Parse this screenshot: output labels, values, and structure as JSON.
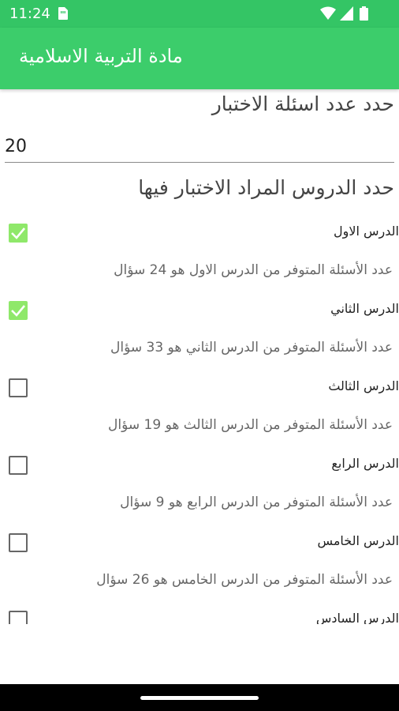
{
  "status_bar": {
    "time": "11:24",
    "icons": [
      "sim-card-icon",
      "wifi-icon",
      "signal-icon",
      "battery-icon"
    ],
    "color": "#34c565"
  },
  "app_bar": {
    "title": "مادة التربية الاسلامية",
    "color": "#3ccd6b"
  },
  "quiz": {
    "count_label": "حدد عدد اسئلة الاختبار",
    "count_value": "20",
    "lessons_label": "حدد الدروس المراد الاختبار فيها"
  },
  "lessons": [
    {
      "title": "الدرس الاول",
      "count_text": "عدد الأسئلة المتوفر من الدرس الاول هو 24 سؤال",
      "checked": true
    },
    {
      "title": "الدرس الثاني",
      "count_text": "عدد الأسئلة المتوفر من الدرس الثاني هو 33 سؤال",
      "checked": true
    },
    {
      "title": "الدرس الثالث",
      "count_text": "عدد الأسئلة المتوفر من الدرس الثالث هو 19 سؤال",
      "checked": false
    },
    {
      "title": "الدرس الرابع",
      "count_text": "عدد الأسئلة المتوفر من الدرس الرابع هو 9 سؤال",
      "checked": false
    },
    {
      "title": "الدرس الخامس",
      "count_text": "عدد الأسئلة المتوفر من الدرس الخامس هو 26 سؤال",
      "checked": false
    },
    {
      "title": "الدرس السادس",
      "count_text": "",
      "checked": false
    }
  ],
  "colors": {
    "checkbox_checked": "#8fe86a",
    "text_primary": "#222222",
    "text_secondary": "#666666"
  }
}
